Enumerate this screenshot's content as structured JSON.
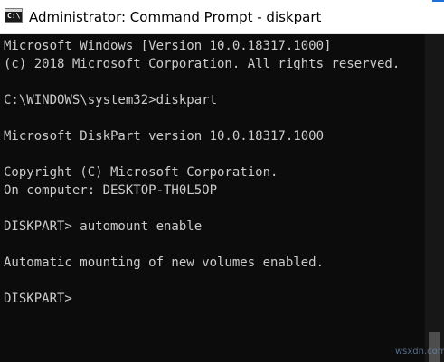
{
  "window": {
    "title": "Administrator: Command Prompt - diskpart",
    "app_icon": "cmd-icon",
    "app_icon_glyph": "C:\\"
  },
  "console": {
    "lines": [
      "Microsoft Windows [Version 10.0.18317.1000]",
      "(c) 2018 Microsoft Corporation. All rights reserved.",
      "",
      "C:\\WINDOWS\\system32>diskpart",
      "",
      "Microsoft DiskPart version 10.0.18317.1000",
      "",
      "Copyright (C) Microsoft Corporation.",
      "On computer: DESKTOP-TH0L5OP",
      "",
      "DISKPART> automount enable",
      "",
      "Automatic mounting of new volumes enabled.",
      "",
      "DISKPART>"
    ]
  },
  "watermark": {
    "text": "wsxdn.com"
  },
  "colors": {
    "console_bg": "#0c0c0c",
    "console_text": "#cccccc",
    "titlebar_bg": "#ffffff",
    "accent": "#1e6fd9"
  }
}
